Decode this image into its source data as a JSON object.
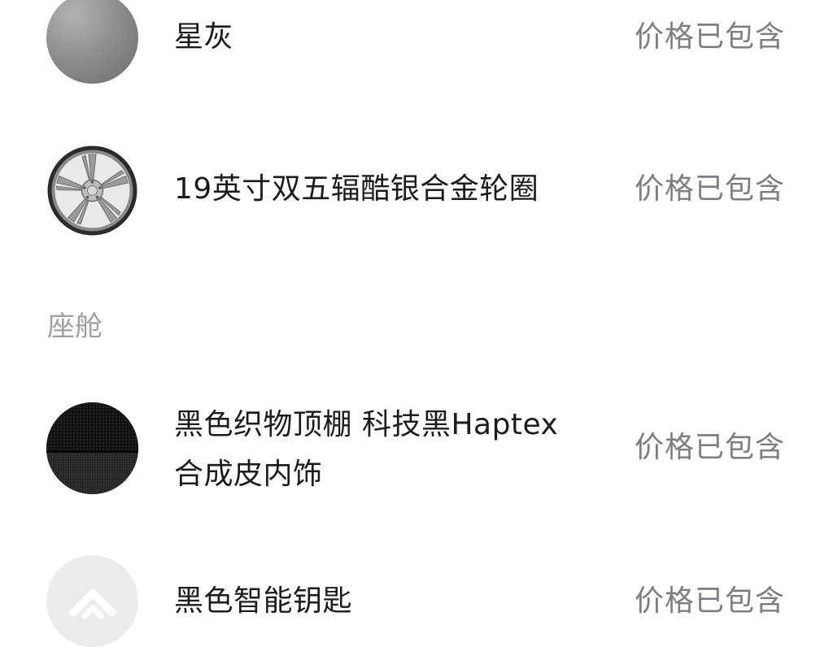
{
  "items": [
    {
      "title": "星灰",
      "price": "价格已包含",
      "icon": "color-swatch-icon"
    },
    {
      "title": "19英寸双五辐酷银合金轮圈",
      "price": "价格已包含",
      "icon": "wheel-icon"
    },
    {
      "title": "黑色织物顶棚 科技黑Haptex\n合成皮内饰",
      "price": "价格已包含",
      "icon": "interior-swatch-icon"
    },
    {
      "title": "黑色智能钥匙",
      "price": "价格已包含",
      "icon": "key-logo-icon"
    }
  ],
  "section_title": "座舱",
  "colors": {
    "title_text": "#1c1c1c",
    "price_text": "#7d7e83",
    "section_text": "#9fa0a6"
  }
}
